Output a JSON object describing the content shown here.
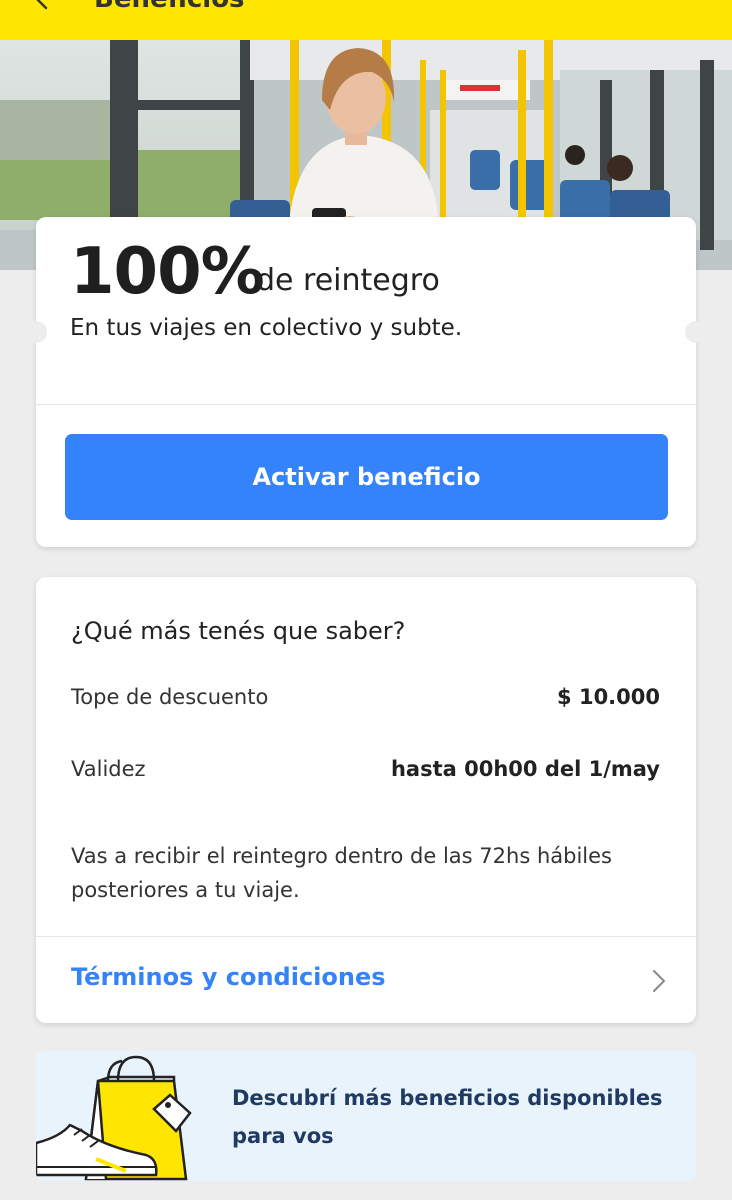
{
  "header": {
    "title": "Beneficios",
    "back_icon": "arrow-left-icon",
    "background": "#ffe600"
  },
  "benefit": {
    "percentage": "100%",
    "percentage_label": "de reintegro",
    "subtitle": "En tus viajes en colectivo y subte.",
    "activate_label": "Activar beneficio",
    "accent": "#3483fa"
  },
  "info": {
    "title": "¿Qué más tenés que saber?",
    "rows": [
      {
        "label": "Tope de descuento",
        "value": "$ 10.000"
      },
      {
        "label": "Validez",
        "value": "hasta 00h00 del 1/may"
      }
    ],
    "note": "Vas a recibir el reintegro dentro de las 72hs hábiles posteriores a tu viaje.",
    "terms_label": "Términos y condiciones",
    "terms_icon": "chevron-right-icon"
  },
  "promo": {
    "text": "Descubrí más beneficios disponibles para vos",
    "icon": "shopping-bag-sneaker-illustration"
  }
}
